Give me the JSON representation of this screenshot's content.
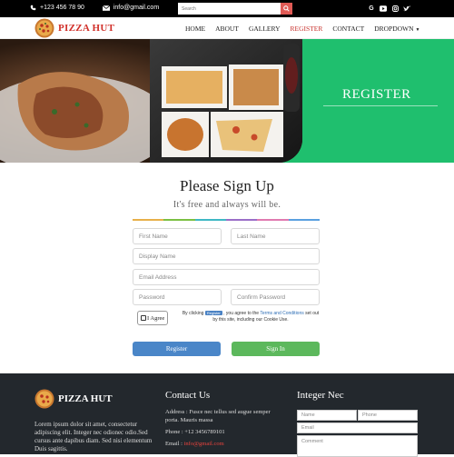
{
  "topbar": {
    "phone": "+123 456 78 90",
    "email": "info@gmail.com",
    "search_placeholder": "Search",
    "social": [
      "google-icon",
      "youtube-icon",
      "instagram-icon",
      "twitter-icon"
    ]
  },
  "nav": {
    "brand": "PIZZA HUT",
    "items": [
      "HOME",
      "ABOUT",
      "GALLERY",
      "REGISTER",
      "CONTACT",
      "DROPDOWN"
    ],
    "active": "REGISTER"
  },
  "hero": {
    "title": "REGISTER"
  },
  "form": {
    "heading": "Please Sign Up",
    "subheading": "It's free and always will be.",
    "first_name_placeholder": "First Name",
    "last_name_placeholder": "Last Name",
    "display_name_placeholder": "Display Name",
    "email_placeholder": "Email Address",
    "password_placeholder": "Password",
    "confirm_password_placeholder": "Confirm Password",
    "agree_label": "I Agree",
    "terms_prefix": "By clicking",
    "terms_register_badge": "Register",
    "terms_middle": ", you agree to the",
    "terms_link": "Terms and Conditions",
    "terms_suffix": "set out by this site, including our Cookie Use.",
    "register_button": "Register",
    "signin_button": "Sign In",
    "colors": [
      "#e8b04a",
      "#7bc043",
      "#3fb8c4",
      "#9b6fc8",
      "#e07ab0",
      "#5aa0e0"
    ]
  },
  "footer": {
    "brand": "PIZZA HUT",
    "description": "Lorem ipsum dolor sit amet, consectetur adipiscing elit. Integer nec odionec odio.Sed cursus ante dapibus diam. Sed nisi elementum Duis sagittis.",
    "contact_heading": "Contact Us",
    "address": "Address : Fusce nec tellus sed augue semper porta. Mauris massa",
    "phone": "Phone : +12 3456789101",
    "email_label": "Email :",
    "email_value": "info@gmail.com",
    "newsletter_heading": "Integer Nec",
    "name_placeholder": "Name",
    "phone_placeholder": "Phone",
    "email_placeholder": "Email",
    "comment_placeholder": "Comment"
  },
  "colors": {
    "accent_red": "#d1302a",
    "hero_green": "#1fbf6e",
    "register_blue": "#4a86c8",
    "signin_green": "#5cb85c",
    "footer_bg": "#23282d"
  }
}
